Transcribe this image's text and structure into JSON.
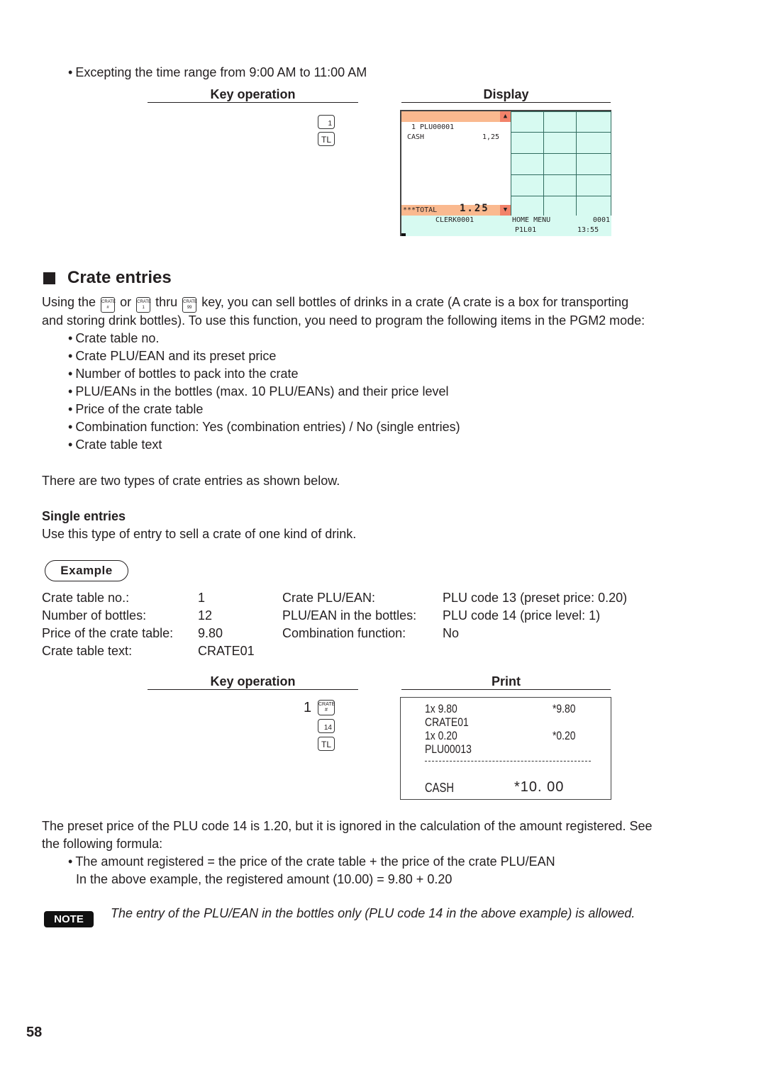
{
  "intro_bullet": "Excepting the time range from 9:00 AM to 11:00 AM",
  "section1": {
    "key_operation_header": "Key operation",
    "display_header": "Display",
    "keys": [
      {
        "label": "1",
        "type": "number"
      },
      {
        "label": "TL",
        "type": "tl"
      }
    ],
    "display": {
      "arrow_up": "▲",
      "line1": "1 PLU00001",
      "line2_label": "CASH",
      "line2_value": "1,25",
      "total_label": "***TOTAL",
      "total_value": "1.25",
      "arrow_down": "▼",
      "clerk": "CLERK0001",
      "menu": "HOME MENU",
      "counter": "0001",
      "page": "P1L01",
      "time": "13:55"
    }
  },
  "heading": "Crate entries",
  "intro": {
    "part1": "Using the",
    "key1_top": "CRATE",
    "key1_bottom": "#",
    "part2": "or",
    "key2_top": "CRATE",
    "key2_bottom": "1",
    "part3": "thru",
    "key3_top": "CRATE",
    "key3_bottom": "99",
    "part4": "key, you can sell bottles of drinks in a crate (A crate is a box for transporting",
    "line2": "and storing drink bottles). To use this function, you need to program the following items in the PGM2 mode:"
  },
  "program_items": [
    "Crate table no.",
    "Crate PLU/EAN and its preset price",
    "Number of bottles to pack into the crate",
    "PLU/EANs in the bottles (max. 10 PLU/EANs) and their price level",
    "Price of the crate table",
    "Combination function: Yes (combination entries) / No (single entries)",
    "Crate table text"
  ],
  "types_text": "There are two types of crate entries as shown below.",
  "single_entries": {
    "title": "Single entries",
    "desc": "Use this type of entry to sell a crate of one kind of drink."
  },
  "example_label": "Example",
  "example_left": [
    {
      "label": "Crate table no.:",
      "value": "1"
    },
    {
      "label": "Number of bottles:",
      "value": "12"
    },
    {
      "label": "Price of the crate table:",
      "value": "9.80"
    },
    {
      "label": "Crate table text:",
      "value": "CRATE01"
    }
  ],
  "example_right": [
    {
      "label": "Crate PLU/EAN:",
      "value": "PLU code 13 (preset price: 0.20)"
    },
    {
      "label": "PLU/EAN in the bottles:",
      "value": "PLU code 14 (price level: 1)"
    },
    {
      "label": "Combination function:",
      "value": "No"
    }
  ],
  "section2": {
    "key_operation_header": "Key operation",
    "print_header": "Print",
    "prefix": "1",
    "keys": [
      {
        "top": "CRATE",
        "bottom": "#"
      },
      {
        "label": "14"
      },
      {
        "label": "TL"
      }
    ],
    "receipt": {
      "l1_left": "1x 9.80",
      "l1_right": "*9.80",
      "l2": "CRATE01",
      "l3_left": "1x 0.20",
      "l3_right": "*0.20",
      "l4": "PLU00013",
      "divider": "--------------------------------",
      "cash_label": "CASH",
      "cash_value": "*10. 00"
    }
  },
  "after_text": {
    "line1": "The preset price of the PLU code 14 is 1.20, but it is ignored in the calculation of the amount registered. See",
    "line2": "the following formula:",
    "formula": "The amount registered = the price of the crate table + the price of the crate PLU/EAN",
    "example": "In the above example, the registered amount (10.00) = 9.80 + 0.20"
  },
  "note": {
    "badge": "NOTE",
    "text": "The entry of the PLU/EAN in the bottles only (PLU code 14 in the above example) is allowed."
  },
  "page_number": "58"
}
